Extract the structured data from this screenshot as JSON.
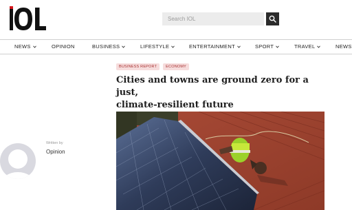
{
  "brand": {
    "logo_text": "IOL",
    "accent": "#d4151c"
  },
  "search": {
    "placeholder": "Search IOL",
    "icon": "search-icon"
  },
  "nav": {
    "items": [
      {
        "label": "NEWS",
        "dropdown": true
      },
      {
        "label": "OPINION",
        "dropdown": false
      },
      {
        "label": "BUSINESS",
        "dropdown": true
      },
      {
        "label": "LIFESTYLE",
        "dropdown": true
      },
      {
        "label": "ENTERTAINMENT",
        "dropdown": true
      },
      {
        "label": "SPORT",
        "dropdown": true
      },
      {
        "label": "TRAVEL",
        "dropdown": true
      },
      {
        "label": "NEWS",
        "dropdown": false
      }
    ]
  },
  "article": {
    "tags": [
      "BUSINESS REPORT",
      "ECONOMY"
    ],
    "headline_line1": "Cities and towns are ground zero for a just,",
    "headline_line2": "climate-resilient future",
    "author": {
      "written_by_label": "Written by",
      "name": "Opinion"
    },
    "hero_image": "solar-panel-installation-photo"
  }
}
